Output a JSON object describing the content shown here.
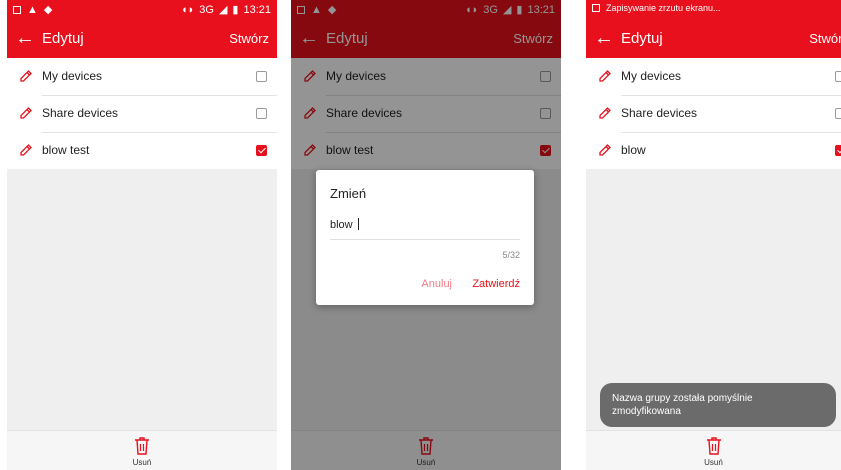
{
  "status": {
    "time": "13:21",
    "network": "3G",
    "notification_text": "Zapisywanie zrzutu ekranu..."
  },
  "appbar": {
    "title": "Edytuj",
    "action": "Stwórz"
  },
  "screen1": {
    "items": [
      {
        "label": "My devices",
        "checked": false
      },
      {
        "label": "Share devices",
        "checked": false
      },
      {
        "label": "blow test",
        "checked": true
      }
    ]
  },
  "screen2": {
    "items": [
      {
        "label": "My devices",
        "checked": false
      },
      {
        "label": "Share devices",
        "checked": false
      },
      {
        "label": "blow test",
        "checked": true
      }
    ],
    "dialog": {
      "title": "Zmień",
      "input_value": "blow ",
      "counter": "5/32",
      "cancel": "Anuluj",
      "confirm": "Zatwierdź"
    }
  },
  "screen3": {
    "items": [
      {
        "label": "My devices",
        "checked": false
      },
      {
        "label": "Share devices",
        "checked": false
      },
      {
        "label": "blow",
        "checked": true
      }
    ],
    "toast": "Nazwa grupy została pomyślnie zmodyfikowana"
  },
  "bottombar": {
    "delete_label": "Usuń"
  },
  "colors": {
    "accent": "#e8101c",
    "background": "#efefef",
    "toast": "#6b6b6b"
  },
  "icons": [
    "back-arrow-icon",
    "edit-pencil-icon",
    "trash-icon",
    "checkbox-icon"
  ]
}
